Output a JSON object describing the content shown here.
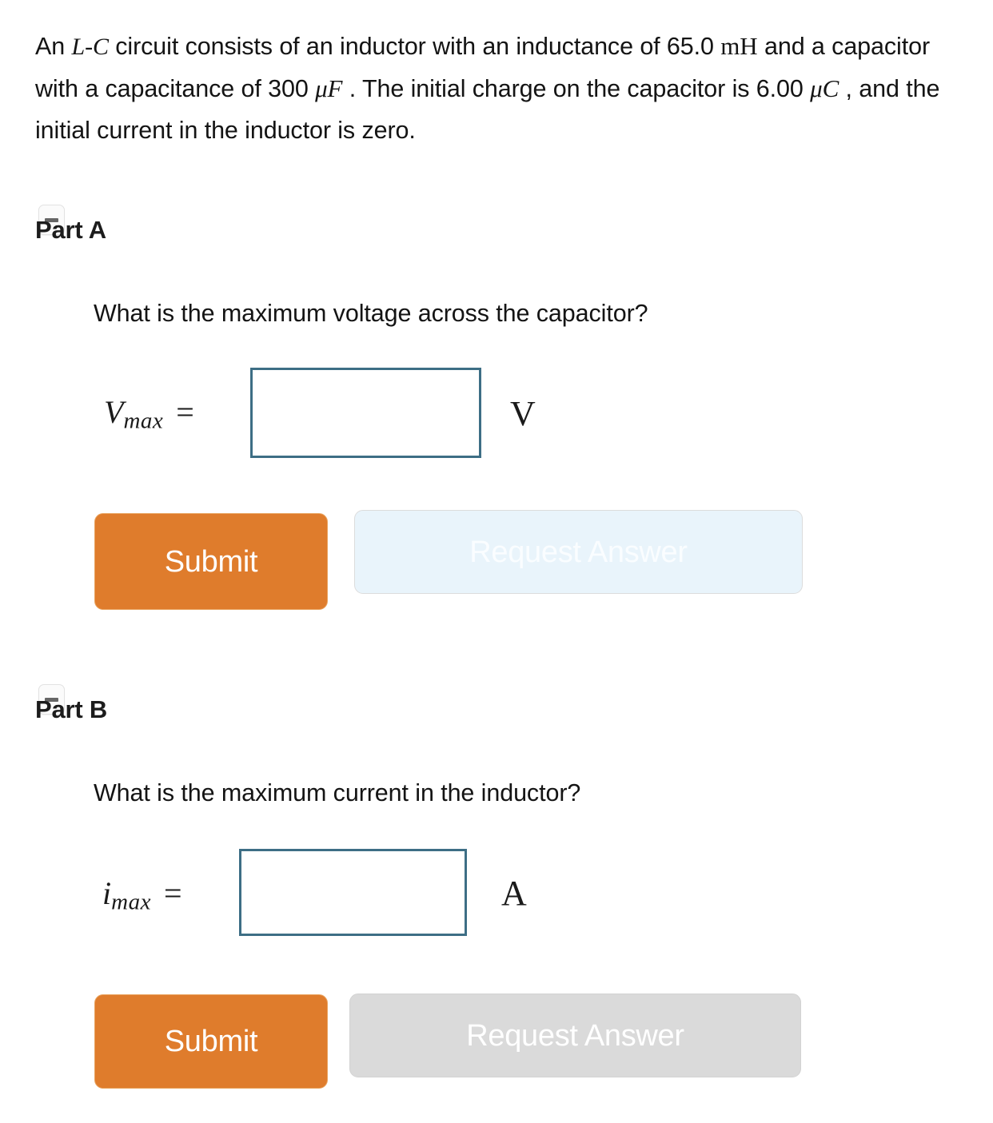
{
  "problem": {
    "segments": [
      {
        "t": "An ",
        "s": "plain"
      },
      {
        "t": "L-C",
        "s": "italic-serif"
      },
      {
        "t": " circuit consists of an inductor with an inductance of 65.0 ",
        "s": "plain"
      },
      {
        "t": "mH",
        "s": "roman-serif"
      },
      {
        "t": " and a capacitor with a capacitance of 300 ",
        "s": "plain"
      },
      {
        "t": "μF",
        "s": "roman-serif"
      },
      {
        "t": " . The initial charge on the capacitor is 6.00 ",
        "s": "plain"
      },
      {
        "t": "μC",
        "s": "roman-serif"
      },
      {
        "t": " , and the initial current in the inductor is zero.",
        "s": "plain"
      }
    ],
    "full_text": "An L-C circuit consists of an inductor with an inductance of 65.0 mH and a capacitor with a capacitance of 300 μF . The initial charge on the capacitor is 6.00 μC , and the initial current in the inductor is zero.",
    "inductance": "65.0 mH",
    "capacitance": "300 μF",
    "initial_charge": "6.00 μC",
    "initial_current": "zero"
  },
  "colors": {
    "submit_orange": "#df7c2c",
    "input_border_blue": "#3d6e85",
    "request_disabled_bg": "#e9f4fb",
    "request_enabled_bg": "#dadada",
    "text": "#141414"
  },
  "parts": [
    {
      "id": "a",
      "collapse_icon": "minus-icon",
      "title": "Part A",
      "question": "What is the maximum voltage across the capacitor?",
      "answer": {
        "variable": "V",
        "subscript": "max",
        "equals": "=",
        "value": "",
        "placeholder": "",
        "unit": "V"
      },
      "submit_label": "Submit",
      "request_label": "Request Answer",
      "request_state": "disabled"
    },
    {
      "id": "b",
      "collapse_icon": "minus-icon",
      "title": "Part B",
      "question": "What is the maximum current in the inductor?",
      "answer": {
        "variable": "i",
        "subscript": "max",
        "equals": "=",
        "value": "",
        "placeholder": "",
        "unit": "A"
      },
      "submit_label": "Submit",
      "request_label": "Request Answer",
      "request_state": "enabled"
    }
  ]
}
